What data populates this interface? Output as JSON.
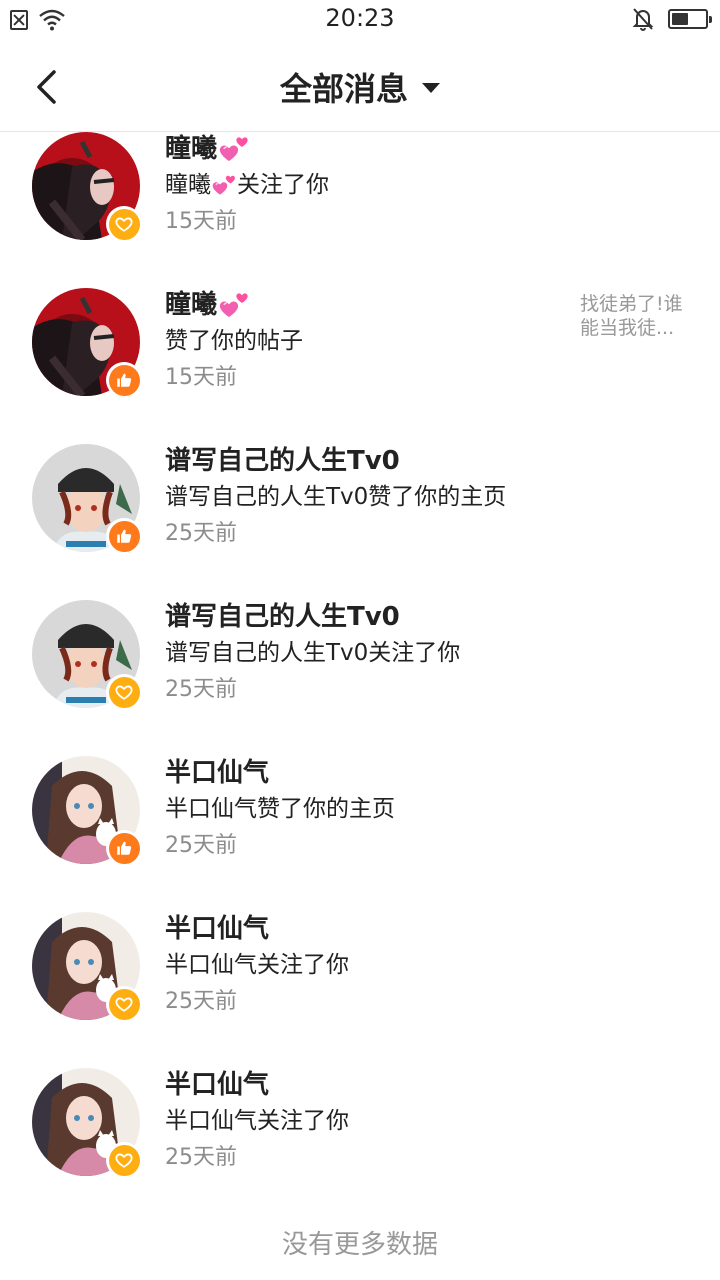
{
  "status_bar": {
    "time": "20:23",
    "battery_level": 0.5
  },
  "nav": {
    "title": "全部消息"
  },
  "icons": {
    "back": "chevron-left-icon",
    "dropdown": "caret-down-icon",
    "follow_badge": "heart-icon",
    "like_badge": "thumbs-up-icon"
  },
  "colors": {
    "follow_badge": "#ffae12",
    "like_badge": "#ff7a1a",
    "timestamp": "#8c8c8c"
  },
  "messages": [
    {
      "name": "瞳曦",
      "text_before": "瞳曦",
      "text_after": "关注了你",
      "time": "15天前",
      "type": "follow"
    },
    {
      "name": "瞳曦",
      "text": "赞了你的帖子",
      "time": "15天前",
      "type": "like",
      "preview": "找徒弟了!谁能当我徒..."
    },
    {
      "name": "谱写自己的人生Tv0",
      "text": "谱写自己的人生Tv0赞了你的主页",
      "time": "25天前",
      "type": "like"
    },
    {
      "name": "谱写自己的人生Tv0",
      "text": "谱写自己的人生Tv0关注了你",
      "time": "25天前",
      "type": "follow"
    },
    {
      "name": "半口仙气",
      "text": "半口仙气赞了你的主页",
      "time": "25天前",
      "type": "like"
    },
    {
      "name": "半口仙气",
      "text": "半口仙气关注了你",
      "time": "25天前",
      "type": "follow"
    },
    {
      "name": "半口仙气",
      "text": "半口仙气关注了你",
      "time": "25天前",
      "type": "follow"
    }
  ],
  "footer": {
    "no_more": "没有更多数据"
  }
}
